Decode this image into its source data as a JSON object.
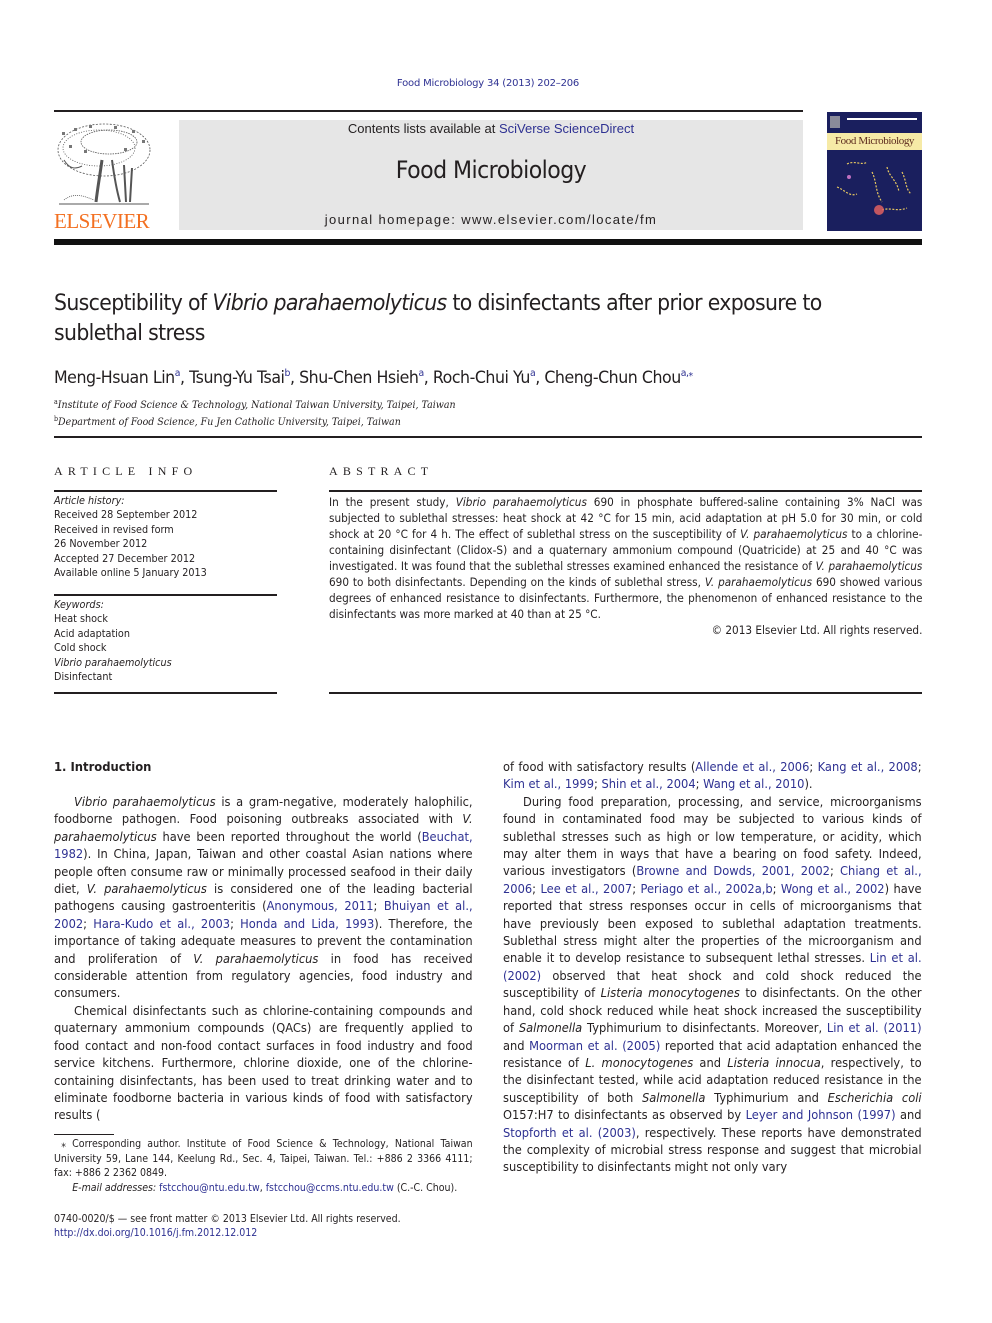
{
  "header": {
    "journal_ref": "Food Microbiology 34 (2013) 202–206",
    "contents_prefix": "Contents lists available at ",
    "contents_link": "SciVerse ScienceDirect",
    "journal_title": "Food Microbiology",
    "homepage_prefix": "journal homepage: ",
    "homepage_url": "www.elsevier.com/locate/fm",
    "publisher_logo_text": "ELSEVIER",
    "cover_title": "Food Microbiology"
  },
  "article": {
    "title_part1": "Susceptibility of ",
    "title_italic": "Vibrio parahaemolyticus",
    "title_part2": " to disinfectants after prior exposure to sublethal stress",
    "authors": [
      {
        "name": "Meng-Hsuan Lin",
        "aff": "a"
      },
      {
        "name": "Tsung-Yu Tsai",
        "aff": "b"
      },
      {
        "name": "Shu-Chen Hsieh",
        "aff": "a"
      },
      {
        "name": "Roch-Chui Yu",
        "aff": "a"
      },
      {
        "name": "Cheng-Chun Chou",
        "aff": "a,⁎"
      }
    ],
    "affiliations": [
      {
        "mark": "a",
        "text": "Institute of Food Science & Technology, National Taiwan University, Taipei, Taiwan"
      },
      {
        "mark": "b",
        "text": "Department of Food Science, Fu Jen Catholic University, Taipei, Taiwan"
      }
    ]
  },
  "article_info": {
    "heading": "ARTICLE INFO",
    "history_label": "Article history:",
    "history": [
      "Received 28 September 2012",
      "Received in revised form",
      "26 November 2012",
      "Accepted 27 December 2012",
      "Available online 5 January 2013"
    ],
    "keywords_label": "Keywords:",
    "keywords": [
      {
        "text": "Heat shock",
        "italic": false
      },
      {
        "text": "Acid adaptation",
        "italic": false
      },
      {
        "text": "Cold shock",
        "italic": false
      },
      {
        "text": "Vibrio parahaemolyticus",
        "italic": true
      },
      {
        "text": "Disinfectant",
        "italic": false
      }
    ]
  },
  "abstract": {
    "heading": "ABSTRACT",
    "s1a": "In the present study, ",
    "s1i": "Vibrio parahaemolyticus",
    "s1b": " 690 in phosphate buffered-saline containing 3% NaCl was subjected to sublethal stresses: heat shock at 42 °C for 15 min, acid adaptation at pH 5.0 for 30 min, or cold shock at 20 °C for 4 h. The effect of sublethal stress on the susceptibility of ",
    "s2i": "V. parahaemolyticus",
    "s2b": " to a chlorine-containing disinfectant (Clidox-S) and a quaternary ammonium compound (Quatricide) at 25 and 40 °C was investigated. It was found that the sublethal stresses examined enhanced the resistance of ",
    "s3i": "V. parahaemolyticus",
    "s3b": " 690 to both disinfectants. Depending on the kinds of sublethal stress, ",
    "s4i": "V. parahaemolyticus",
    "s4b": " 690 showed various degrees of enhanced resistance to disinfectants. Furthermore, the phenomenon of enhanced resistance to the disinfectants was more marked at 40 than at 25 °C.",
    "copyright": "© 2013 Elsevier Ltd. All rights reserved."
  },
  "intro": {
    "heading": "1.  Introduction",
    "p1": {
      "a": "Vibrio parahaemolyticus",
      "b": " is a gram-negative, moderately halophilic, foodborne pathogen. Food poisoning outbreaks associated with ",
      "c": "V. parahaemolyticus",
      "d": " have been reported throughout the world (",
      "ref1": "Beuchat, 1982",
      "e": "). In China, Japan, Taiwan and other coastal Asian nations where people often consume raw or minimally processed seafood in their daily diet, ",
      "f": "V. parahaemolyticus",
      "g": " is considered one of the leading bacterial pathogens causing gastroenteritis (",
      "ref2": "Anonymous, 2011",
      "sep1": "; ",
      "ref3": "Bhuiyan et al., 2002",
      "sep2": "; ",
      "ref4": "Hara-Kudo et al., 2003",
      "sep3": "; ",
      "ref5": "Honda and Lida, 1993",
      "h": "). Therefore, the importance of taking adequate measures to prevent the contamination and proliferation of ",
      "i": "V. parahaemolyticus",
      "j": " in food has received considerable attention from regulatory agencies, food industry and consumers."
    },
    "p2": {
      "a": "Chemical disinfectants such as chlorine-containing compounds and quaternary ammonium compounds (QACs) are frequently applied to food contact and non-food contact surfaces in food industry and food service kitchens. Furthermore, chlorine dioxide, one of the chlorine-containing disinfectants, has been used to treat drinking water and to eliminate foodborne bacteria in various kinds of food with satisfactory results (",
      "ref1": "Allende et al., 2006",
      "ref2": "Kang et al., 2008",
      "ref3": "Kim et al., 1999",
      "ref4": "Shin et al., 2004",
      "ref5": "Wang et al., 2010",
      "end": ")."
    },
    "p3": {
      "a": "During food preparation, processing, and service, microorganisms found in contaminated food may be subjected to various kinds of sublethal stresses such as high or low temperature, or acidity, which may alter them in ways that have a bearing on food safety. Indeed, various investigators (",
      "ref1": "Browne and Dowds, 2001, 2002",
      "ref2": "Chiang et al., 2006",
      "ref3": "Lee et al., 2007",
      "ref4": "Periago et al., 2002a,b",
      "ref5": "Wong et al., 2002",
      "b": ") have reported that stress responses occur in cells of microorganisms that have previously been exposed to sublethal adaptation treatments. Sublethal stress might alter the properties of the microorganism and enable it to develop resistance to subsequent lethal stresses. ",
      "ref6": "Lin et al. (2002)",
      "c": " observed that heat shock and cold shock reduced the susceptibility of ",
      "i1": "Listeria monocytogenes",
      "d": " to disinfectants. On the other hand, cold shock reduced while heat shock increased the susceptibility of ",
      "i2": "Salmonella",
      "e": " Typhimurium to disinfectants. Moreover, ",
      "ref7": "Lin et al. (2011)",
      "f": " and ",
      "ref8": "Moorman et al. (2005)",
      "g": " reported that acid adaptation enhanced the resistance of ",
      "i3": "L. monocytogenes",
      "h": " and ",
      "i4": "Listeria innocua",
      "k": ", respectively, to the disinfectant tested, while acid adaptation reduced resistance in the susceptibility of both ",
      "i5": "Salmonella",
      "l": " Typhimurium and ",
      "i6": "Escherichia coli",
      "m": " O157:H7 to disinfectants as observed by ",
      "ref9": "Leyer and Johnson (1997)",
      "n": " and ",
      "ref10": "Stopforth et al. (2003)",
      "o": ", respectively. These reports have demonstrated the complexity of microbial stress response and suggest that microbial susceptibility to disinfectants might not only vary"
    }
  },
  "footnote": {
    "corresponding": "⁎ Corresponding author. Institute of Food Science & Technology, National Taiwan University 59, Lane 144, Keelung Rd., Sec. 4, Taipei, Taiwan. Tel.: +886 2 3366 4111; fax: +886 2 2362 0849.",
    "email_label": "E-mail addresses:",
    "email1": "fstcchou@ntu.edu.tw",
    "email2": "fstcchou@ccms.ntu.edu.tw",
    "email_suffix": " (C.-C. Chou).",
    "issn": "0740-0020/$ — see front matter © 2013 Elsevier Ltd. All rights reserved.",
    "doi": "http://dx.doi.org/10.1016/j.fm.2012.12.012"
  },
  "colors": {
    "link": "#2e3192",
    "elsevier_orange": "#f37021",
    "header_box": "#e6e6e6"
  }
}
